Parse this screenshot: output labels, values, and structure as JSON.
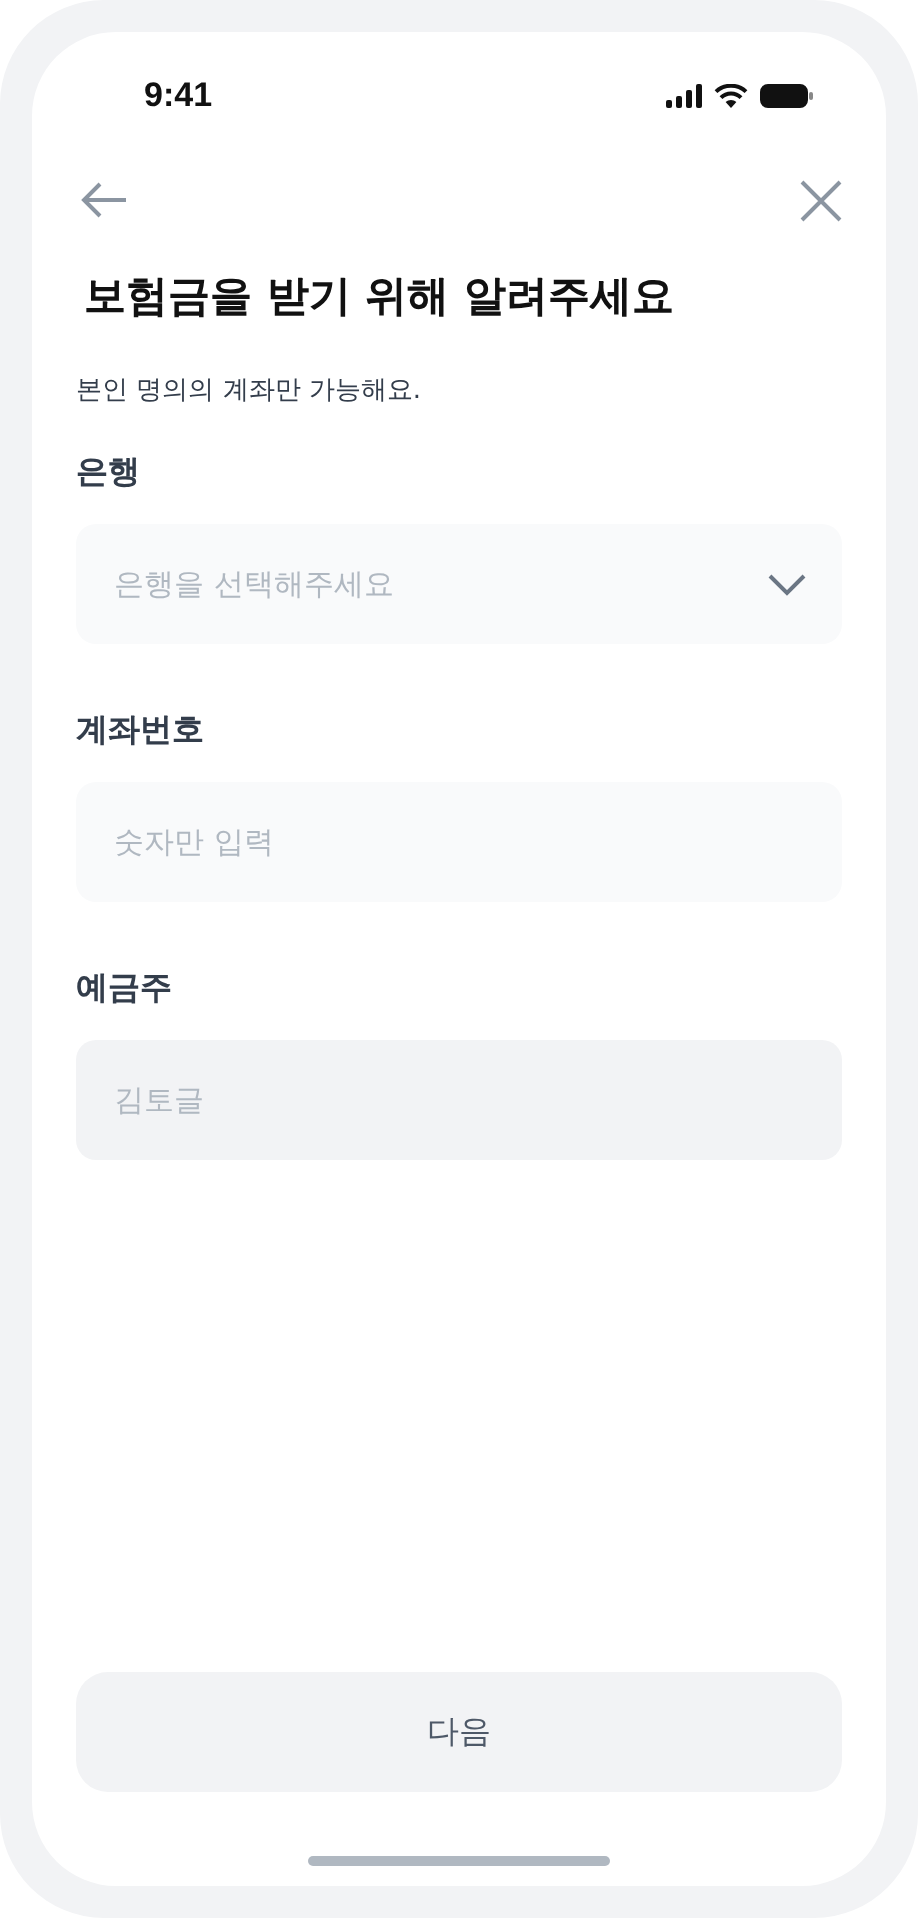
{
  "status_bar": {
    "time": "9:41"
  },
  "title": "보험금을 받기 위해 알려주세요",
  "subtitle": "본인 명의의 계좌만 가능해요.",
  "fields": [
    {
      "kind": "select",
      "label": "은행",
      "placeholder": "은행을 선택해주세요",
      "disabled": false
    },
    {
      "kind": "input",
      "label": "계좌번호",
      "placeholder": "숫자만 입력",
      "disabled": false
    },
    {
      "kind": "input",
      "label": "예금주",
      "value": "김토글",
      "disabled": true
    }
  ],
  "next_button": {
    "label": "다음",
    "disabled": true
  }
}
